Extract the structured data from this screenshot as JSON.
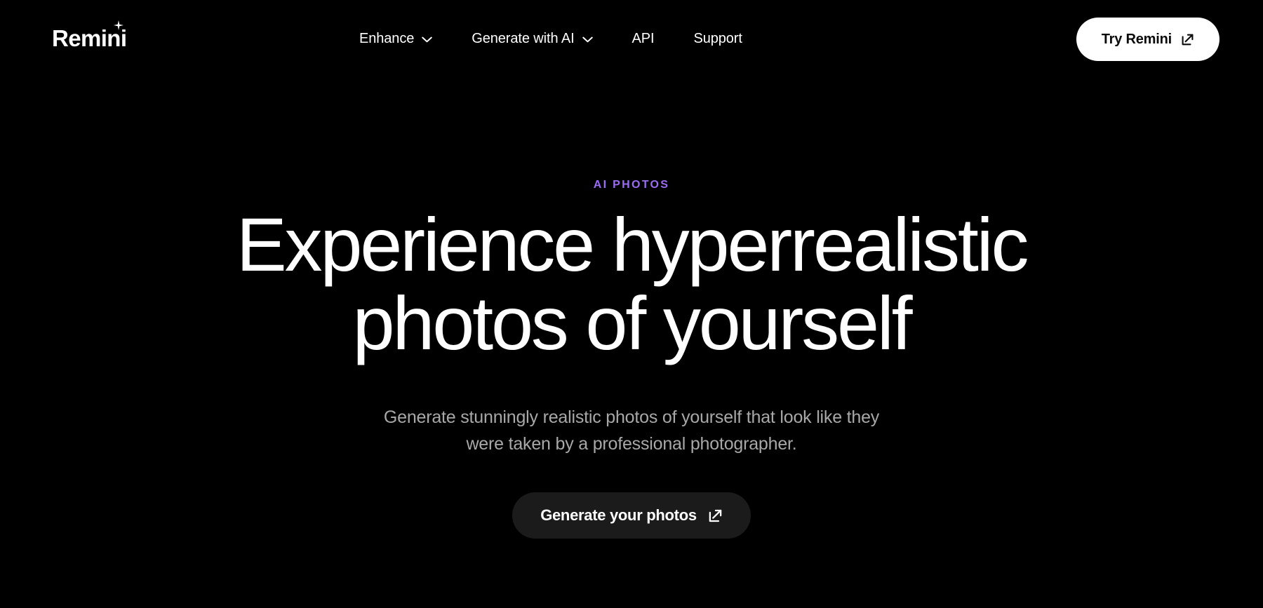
{
  "theme": {
    "background": "#000000",
    "text_primary": "#FFFFFF",
    "text_muted": "#A8A8A8",
    "accent_purple": "#9B6DF3",
    "cta_fill": "#1B1B1B",
    "try_button_fill": "#FFFFFF",
    "try_button_text": "#0B0B0B"
  },
  "header": {
    "brand": {
      "name": "Remini",
      "sparkle_icon": "sparkle-icon"
    },
    "nav": [
      {
        "label": "Enhance",
        "has_dropdown": true,
        "icon": "chevron-down-icon"
      },
      {
        "label": "Generate with AI",
        "has_dropdown": true,
        "icon": "chevron-down-icon"
      },
      {
        "label": "API",
        "has_dropdown": false,
        "icon": ""
      },
      {
        "label": "Support",
        "has_dropdown": false,
        "icon": ""
      }
    ],
    "cta": {
      "label": "Try Remini",
      "icon": "external-link-icon"
    }
  },
  "hero": {
    "eyebrow": "AI PHOTOS",
    "headline_line1": "Experience hyperrealistic",
    "headline_line2": "photos of yourself",
    "subtitle_line1": "Generate stunningly realistic photos of yourself that look like they",
    "subtitle_line2": "were taken by a professional photographer.",
    "cta": {
      "label": "Generate your photos",
      "icon": "external-link-icon"
    }
  }
}
